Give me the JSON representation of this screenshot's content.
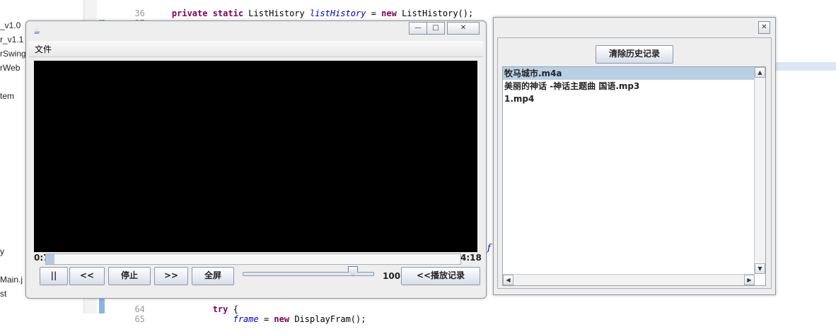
{
  "ide": {
    "tree_items": [
      "_v1.0",
      "r_v1.1",
      "rSwing",
      "rWeb",
      "tem",
      "y",
      "Main.j",
      "st"
    ],
    "code_lines": [
      {
        "num": "36",
        "text": "private static ListHistory listHistory = new ListHistory();"
      },
      {
        "num": "37",
        "text": ""
      },
      {
        "num": "64",
        "text": "try {"
      },
      {
        "num": "65",
        "text": "frame = new DisplayFram();"
      }
    ]
  },
  "player": {
    "title_icon": "java-app-icon",
    "window_controls": {
      "minimize": "—",
      "maximize": "□",
      "close": "✕"
    },
    "menu": {
      "file": "文件"
    },
    "progress": {
      "current": "0:7",
      "total": "4:18",
      "fraction": 0.02
    },
    "buttons": {
      "pause": "||",
      "rewind": "<<",
      "stop": "停止",
      "forward": ">>",
      "fullscreen": "全屏",
      "history": "<<播放记录"
    },
    "volume": {
      "value": "100",
      "fraction": 0.84
    }
  },
  "history": {
    "close": "✕",
    "clear_button": "清除历史记录",
    "items": [
      "牧马城市.m4a",
      "美丽的神话 -神话主题曲 国语.mp3",
      "1.mp4"
    ],
    "selected_index": 0,
    "scroll": {
      "up": "▲",
      "down": "▼",
      "left": "◀",
      "right": "▶"
    }
  }
}
